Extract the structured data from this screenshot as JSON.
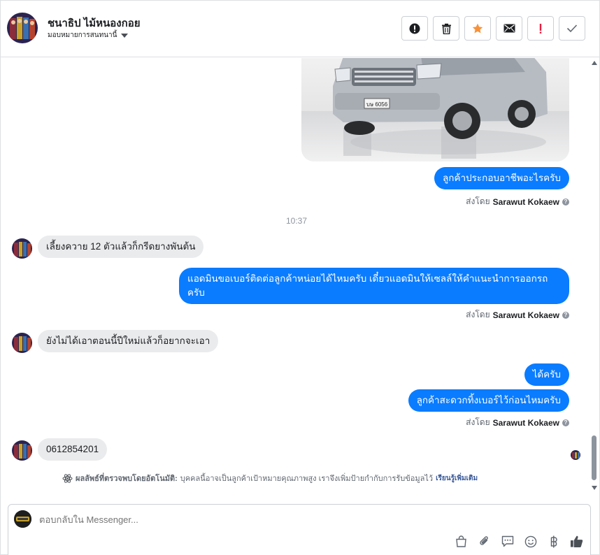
{
  "header": {
    "contact_name": "ชนาธิป ไม้หนองกอย",
    "assign_label": "มอบหมายการสนทนานี้",
    "actions": [
      {
        "name": "report-button",
        "icon": "alert-circle-icon"
      },
      {
        "name": "delete-button",
        "icon": "trash-icon"
      },
      {
        "name": "star-button",
        "icon": "star-icon"
      },
      {
        "name": "mark-unread-button",
        "icon": "envelope-icon"
      },
      {
        "name": "important-button",
        "icon": "exclamation-icon"
      },
      {
        "name": "done-button",
        "icon": "check-icon"
      }
    ]
  },
  "messages": {
    "m1": "ลูกค้าประกอบอาชีพอะไรครับ",
    "sent_by_prefix": "ส่งโดย",
    "sent_by_name": "Sarawut Kokaew",
    "time": "10:37",
    "m2": "เลี้ยงควาย 12 ตัวแล้วก็กรีดยางพันต้น",
    "m3_line1": "แอดมินขอเบอร์ติดต่อลูกค้าหน่อยได้ไหมครับ เดี๋ยวแอดมินให้เซลล์ให้คำแนะนำการออกรถ",
    "m3_line2": "ครับ",
    "m4": "ยังไม่ได้เอาตอนนี้ปีใหม่แล้วก็อยากจะเอา",
    "m5": "ได้ครับ",
    "m6": "ลูกค้าสะดวกทิ้งเบอร์ไว้ก่อนไหมครับ",
    "m7": "0612854201",
    "license_plate": "บษ 6056"
  },
  "auto_detect": {
    "title": "ผลลัพธ์ที่ตรวจพบโดยอัตโนมัติ:",
    "text": "บุคคลนี้อาจเป็นลูกค้าเป้าหมายคุณภาพสูง เราจึงเพิ่มป้ายกำกับการรับข้อมูลไว้",
    "link": "เรียนรู้เพิ่มเติม"
  },
  "composer": {
    "placeholder": "ตอบกลับใน Messenger...",
    "tools": [
      "shopping-bag-icon",
      "paperclip-icon",
      "saved-reply-icon",
      "emoji-icon",
      "baht-icon",
      "thumbs-up-icon"
    ]
  },
  "colors": {
    "outgoing_bubble": "#0a7cff",
    "incoming_bubble": "#eaebed",
    "star": "#f7923b",
    "important": "#e41e3f"
  }
}
